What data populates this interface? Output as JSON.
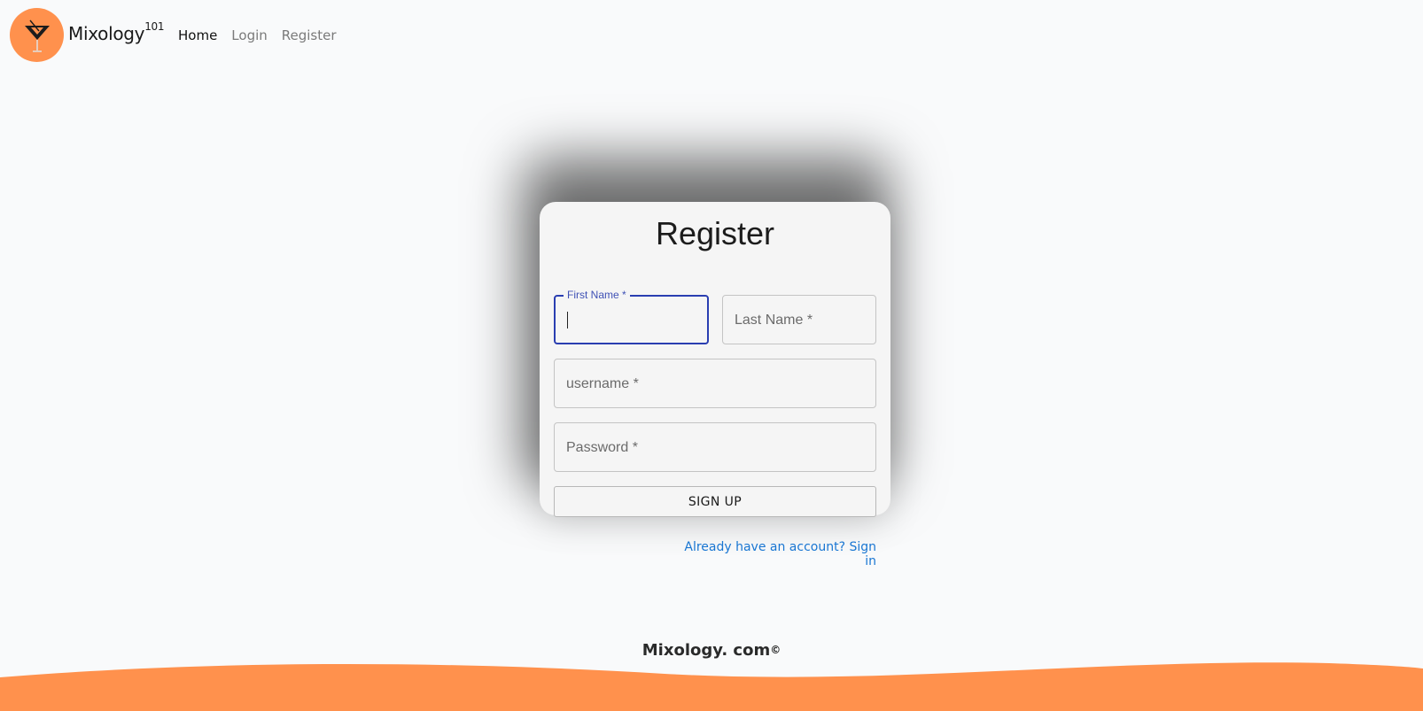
{
  "nav": {
    "brand": "Mixology",
    "brand_sup": "101",
    "links": [
      {
        "label": "Home",
        "active": true
      },
      {
        "label": "Login",
        "active": false
      },
      {
        "label": "Register",
        "active": false
      }
    ]
  },
  "form": {
    "title": "Register",
    "first_name": {
      "label": "First Name *",
      "value": ""
    },
    "last_name": {
      "placeholder": "Last Name *"
    },
    "username": {
      "placeholder": "username *"
    },
    "password": {
      "placeholder": "Password *"
    },
    "submit_label": "SIGN UP",
    "signin_link": "Already have an account? Sign in"
  },
  "footer": {
    "text": "Mixology. com",
    "symbol": "©"
  },
  "colors": {
    "accent": "#ff914d",
    "focus": "#2a3eb1",
    "link": "#1976d2"
  },
  "icons": {
    "logo": "cocktail-glass-icon"
  }
}
